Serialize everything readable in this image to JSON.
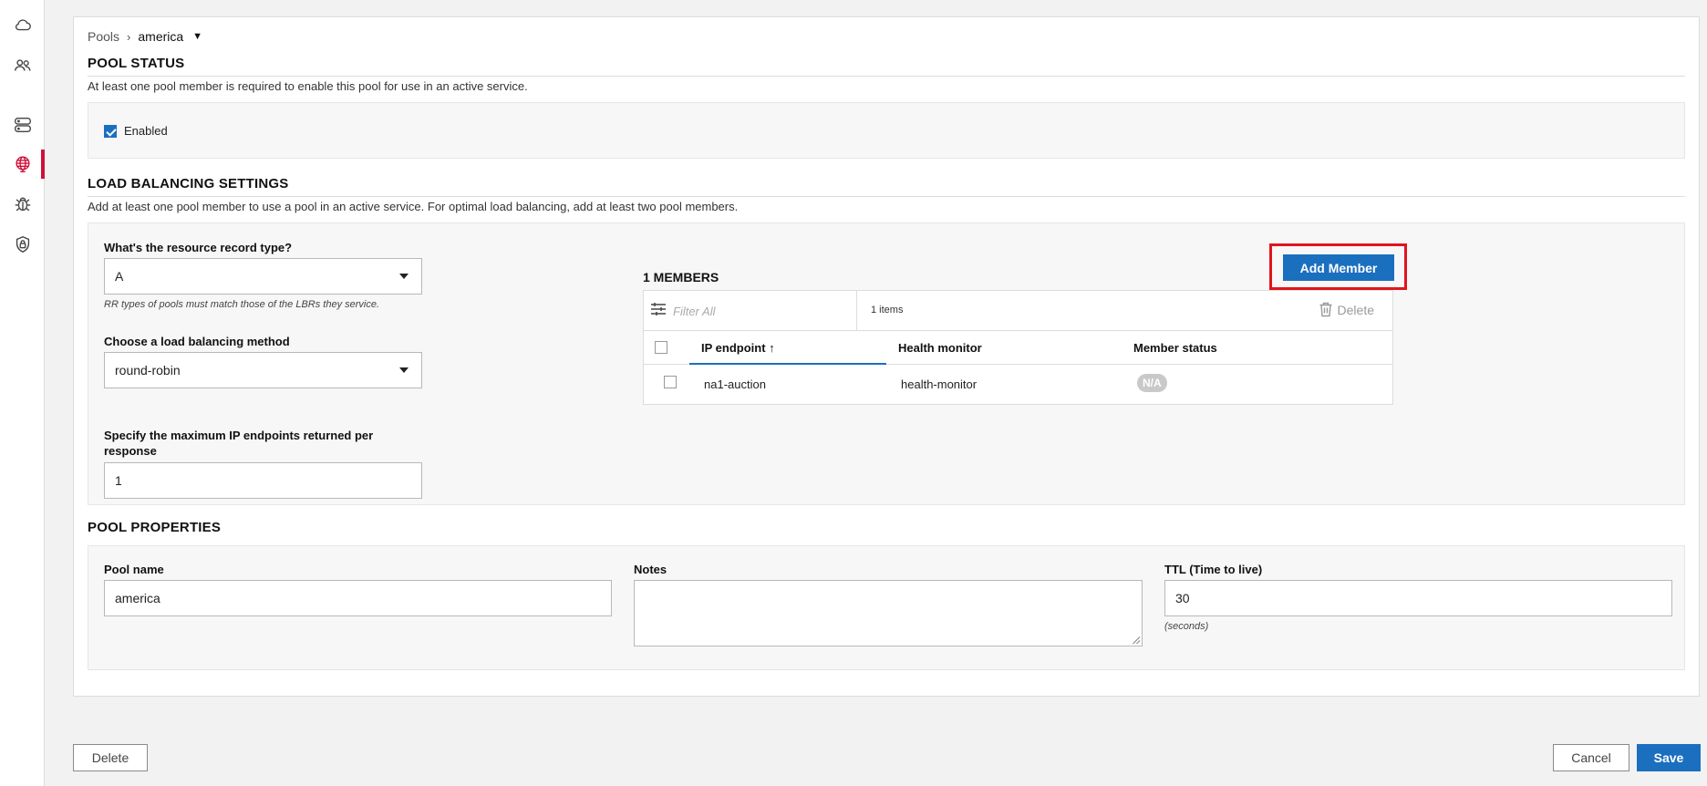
{
  "breadcrumb": {
    "root": "Pools",
    "current": "america"
  },
  "pool_status": {
    "title": "POOL STATUS",
    "description": "At least one pool member is required to enable this pool for use in an active service.",
    "enabled_label": "Enabled",
    "enabled_checked": true
  },
  "load_balancing": {
    "title": "LOAD BALANCING SETTINGS",
    "description": "Add at least one pool member to use a pool in an active service. For optimal load balancing, add at least two pool members.",
    "rr_type_label": "What's the resource record type?",
    "rr_type_value": "A",
    "rr_type_helper": "RR types of pools must match those of the LBRs they service.",
    "method_label": "Choose a load balancing method",
    "method_value": "round-robin",
    "max_ip_label": "Specify the maximum IP endpoints returned per response",
    "max_ip_value": "1"
  },
  "members": {
    "title": "1 MEMBERS",
    "add_button": "Add Member",
    "filter_placeholder": "Filter All",
    "item_count": "1 items",
    "delete_label": "Delete",
    "columns": [
      "IP endpoint",
      "Health monitor",
      "Member status"
    ],
    "sort_indicator": "↑",
    "rows": [
      {
        "ip_endpoint": "na1-auction",
        "health_monitor": "health-monitor",
        "member_status": "N/A"
      }
    ]
  },
  "pool_properties": {
    "title": "POOL PROPERTIES",
    "pool_name_label": "Pool name",
    "pool_name_value": "america",
    "notes_label": "Notes",
    "notes_value": "",
    "ttl_label": "TTL (Time to live)",
    "ttl_value": "30",
    "ttl_helper": "(seconds)"
  },
  "footer": {
    "delete": "Delete",
    "cancel": "Cancel",
    "save": "Save"
  },
  "colors": {
    "primary": "#1b6fbf",
    "highlight": "#e0141e",
    "active_nav": "#d0103a"
  },
  "sidebar": {
    "items": [
      {
        "icon": "cloud-icon"
      },
      {
        "icon": "users-icon"
      },
      {
        "icon": "server-icon"
      },
      {
        "icon": "globe-icon",
        "active": true
      },
      {
        "icon": "bug-icon"
      },
      {
        "icon": "shield-lock-icon"
      }
    ]
  }
}
